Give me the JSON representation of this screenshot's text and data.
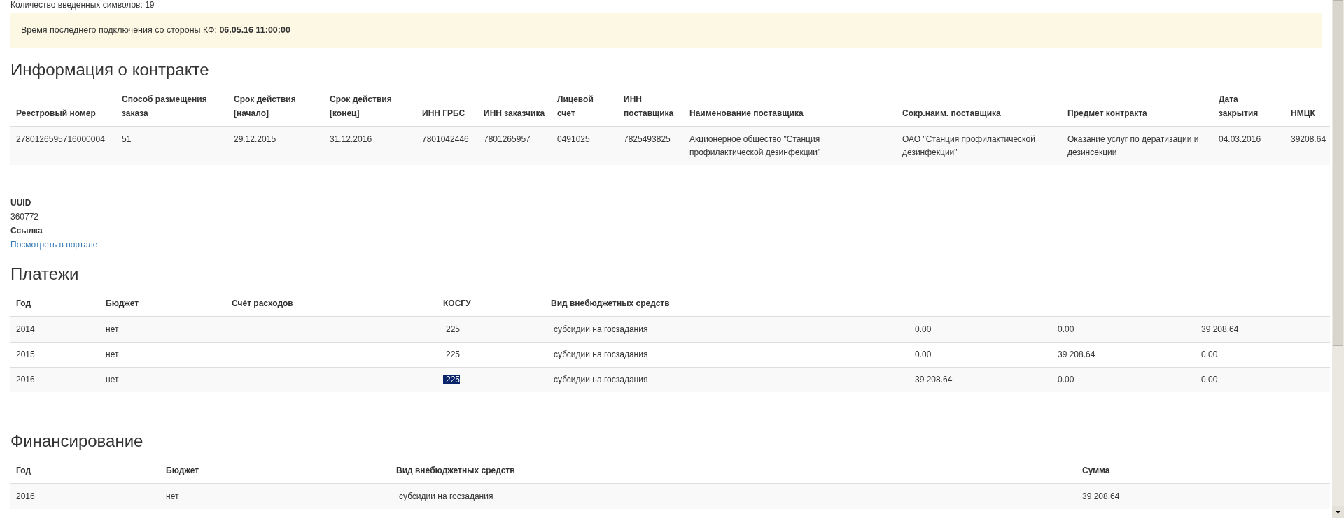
{
  "input_counter": "Количество введенных символов: 19",
  "alert": {
    "label": "Время последнего подключения со стороны КФ:",
    "value": "06.05.16 11:00:00"
  },
  "contract": {
    "title": "Информация о контракте",
    "columns": [
      "Реестровый номер",
      "Способ размещения заказа",
      "Срок действия [начало]",
      "Срок действия [конец]",
      "ИНН ГРБС",
      "ИНН заказчика",
      "Лицевой счет",
      "ИНН поставщика",
      "Наименование поставщика",
      "Сокр.наим. поставщика",
      "Предмет контракта",
      "Дата закрытия",
      "НМЦК"
    ],
    "rows": [
      [
        "2780126595716000004",
        "51",
        "29.12.2015",
        "31.12.2016",
        "7801042446",
        "7801265957",
        "0491025",
        "7825493825",
        "Акционерное общество \"Станция профилактической дезинфекции\"",
        "ОАО \"Станция профилактической дезинфекции\"",
        "Оказание услуг по дератизации и дезинсекции",
        "04.03.2016",
        "39208.64"
      ]
    ]
  },
  "details": [
    {
      "label": "UUID",
      "value": "360772",
      "kind": "text"
    },
    {
      "label": "Ссылка",
      "value": "Посмотреть в портале",
      "kind": "link"
    }
  ],
  "payments": {
    "title": "Платежи",
    "columns": [
      "Год",
      "Бюджет",
      "Счёт расходов",
      "КОСГУ",
      "Вид внебюджетных средств"
    ],
    "rows": [
      {
        "cells": [
          "2014",
          "нет",
          "",
          "225",
          "субсидии на госзадания",
          "0.00",
          "0.00",
          "39 208.64"
        ],
        "selected": false
      },
      {
        "cells": [
          "2015",
          "нет",
          "",
          "225",
          "субсидии на госзадания",
          "0.00",
          "39 208.64",
          "0.00"
        ],
        "selected": false
      },
      {
        "cells": [
          "2016",
          "нет",
          "",
          "225",
          "субсидии на госзадания",
          "39 208.64",
          "0.00",
          "0.00"
        ],
        "selected": true
      }
    ]
  },
  "financing": {
    "title": "Финансирование",
    "columns": [
      "Год",
      "Бюджет",
      "Вид внебюджетных средств",
      "Сумма"
    ],
    "rows": [
      [
        "2016",
        "нет",
        "субсидии на госзадания",
        "39 208.64"
      ]
    ]
  }
}
